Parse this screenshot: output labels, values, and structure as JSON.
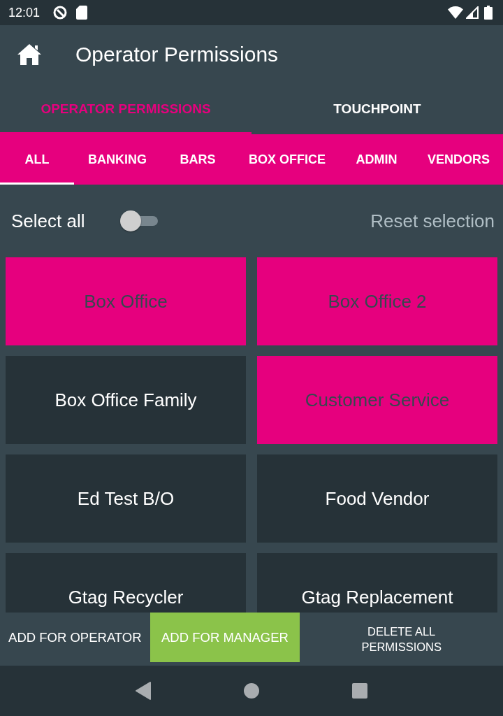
{
  "status_bar": {
    "time": "12:01"
  },
  "app_bar": {
    "title": "Operator Permissions"
  },
  "tabs": [
    {
      "label": "OPERATOR PERMISSIONS",
      "selected": true
    },
    {
      "label": "TOUCHPOINT",
      "selected": false
    }
  ],
  "categories": [
    {
      "label": "ALL",
      "selected": true
    },
    {
      "label": "BANKING",
      "selected": false
    },
    {
      "label": "BARS",
      "selected": false
    },
    {
      "label": "BOX OFFICE",
      "selected": false
    },
    {
      "label": "ADMIN",
      "selected": false
    },
    {
      "label": "VENDORS",
      "selected": false
    }
  ],
  "select_all": {
    "label": "Select all",
    "on": false
  },
  "reset": {
    "label": "Reset selection"
  },
  "permissions": [
    {
      "label": "Box Office",
      "selected": true
    },
    {
      "label": "Box Office 2",
      "selected": true
    },
    {
      "label": "Box Office Family",
      "selected": false
    },
    {
      "label": "Customer Service",
      "selected": true
    },
    {
      "label": "Ed Test B/O",
      "selected": false
    },
    {
      "label": "Food Vendor",
      "selected": false
    },
    {
      "label": "Gtag Recycler",
      "selected": false
    },
    {
      "label": "Gtag Replacement",
      "selected": false
    }
  ],
  "actions": [
    {
      "label": "ADD FOR OPERATOR",
      "kind": "text"
    },
    {
      "label": "ADD FOR MANAGER",
      "kind": "filled"
    },
    {
      "label": "DELETE ALL PERMISSIONS",
      "kind": "stacked"
    }
  ]
}
